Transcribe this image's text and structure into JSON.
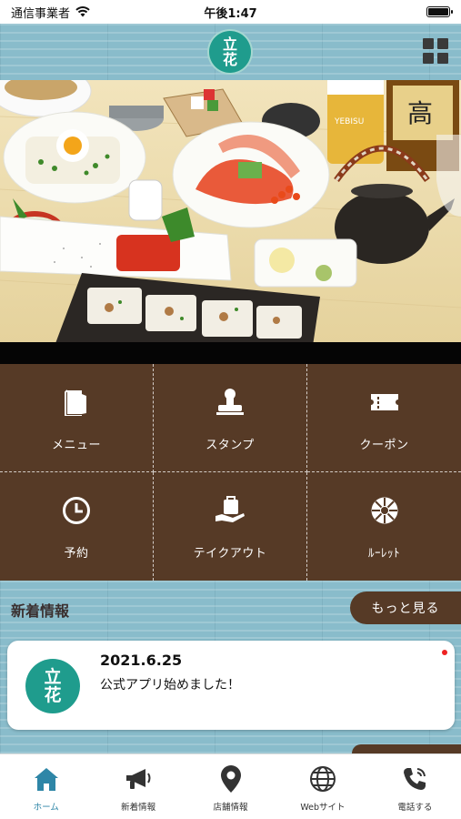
{
  "status_bar": {
    "carrier": "通信事業者",
    "time": "午後1:47"
  },
  "header": {
    "logo_line1": "立",
    "logo_line2": "花"
  },
  "features": [
    {
      "label": "メニュー",
      "icon": "menu-book-icon"
    },
    {
      "label": "スタンプ",
      "icon": "stamp-icon"
    },
    {
      "label": "クーポン",
      "icon": "ticket-icon"
    },
    {
      "label": "予約",
      "icon": "clock-icon"
    },
    {
      "label": "テイクアウト",
      "icon": "takeout-bag-icon"
    },
    {
      "label": "ﾙｰﾚｯﾄ",
      "icon": "roulette-icon"
    }
  ],
  "news": {
    "title": "新着情報",
    "more_label": "もっと見る",
    "items": [
      {
        "date": "2021.6.25",
        "text": "公式アプリ始めました！",
        "logo_line1": "立",
        "logo_line2": "花"
      }
    ]
  },
  "tabbar": {
    "items": [
      {
        "label": "ホーム",
        "icon": "home-icon",
        "active": true
      },
      {
        "label": "新着情報",
        "icon": "megaphone-icon",
        "active": false
      },
      {
        "label": "店舗情報",
        "icon": "map-pin-icon",
        "active": false
      },
      {
        "label": "Webサイト",
        "icon": "globe-icon",
        "active": false
      },
      {
        "label": "電話する",
        "icon": "phone-icon",
        "active": false
      }
    ]
  },
  "colors": {
    "brand_brown": "#563a26",
    "accent_blue": "#2e86a7",
    "logo_teal": "#1f9c8d"
  }
}
